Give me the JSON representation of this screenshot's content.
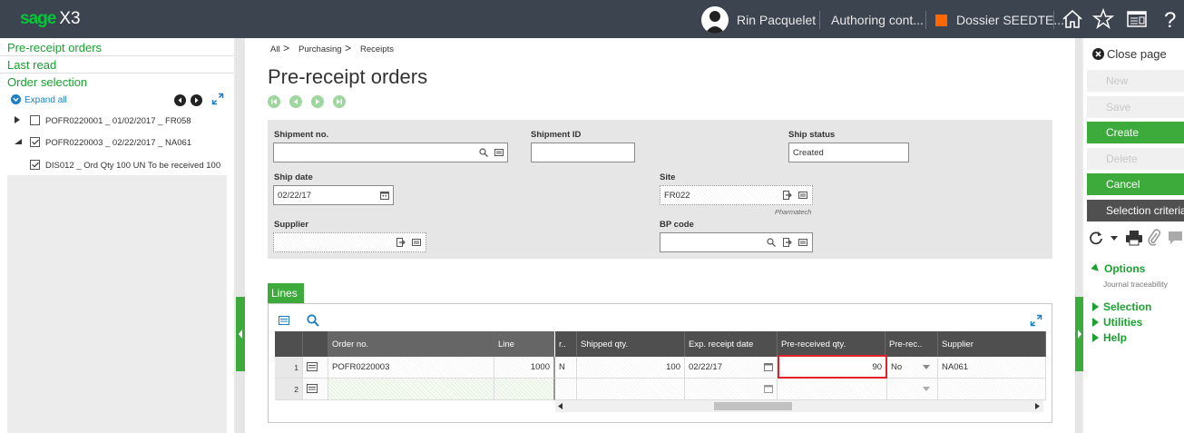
{
  "app": {
    "brand": "sage",
    "product": "X3"
  },
  "topbar": {
    "user": "Rin Pacquelet",
    "context": "Authoring cont...",
    "folder": "Dossier SEEDTE..."
  },
  "left_panel": {
    "links": [
      "Pre-receipt orders",
      "Last read",
      "Order selection"
    ],
    "expand_all": "Expand all",
    "tree": [
      {
        "label": "POFR0220001 _ 01/02/2017 _ FR058",
        "checked": false,
        "expander": "collapsed"
      },
      {
        "label": "POFR0220003 _ 02/22/2017 _ NA061",
        "checked": true,
        "expander": "expanded"
      },
      {
        "label": "DIS012 _ Ord Qty 100 UN To be received 100",
        "checked": true,
        "expander": "none"
      }
    ]
  },
  "breadcrumb": [
    "All",
    "Purchasing",
    "Receipts"
  ],
  "page": {
    "title": "Pre-receipt orders"
  },
  "form": {
    "shipment_no": {
      "label": "Shipment no.",
      "value": ""
    },
    "shipment_id": {
      "label": "Shipment ID",
      "value": ""
    },
    "ship_status": {
      "label": "Ship status",
      "value": "Created"
    },
    "ship_date": {
      "label": "Ship date",
      "value": "02/22/17"
    },
    "site": {
      "label": "Site",
      "value": "FR022",
      "caption": "Pharmatech"
    },
    "supplier": {
      "label": "Supplier",
      "value": ""
    },
    "bp_code": {
      "label": "BP code",
      "value": ""
    }
  },
  "lines": {
    "tab": "Lines",
    "columns": [
      "",
      "",
      "Order no.",
      "Line",
      "r..",
      "Shipped qty.",
      "Exp. receipt date",
      "Pre-received qty.",
      "Pre-rec..",
      "Supplier"
    ],
    "rows": [
      {
        "num": "1",
        "order_no": "POFR0220003",
        "line": "1000",
        "r": "N",
        "shipped": "100",
        "exp_date": "02/22/17",
        "pre_qty": "90",
        "pre_rec": "No",
        "supplier": "NA061"
      },
      {
        "num": "2",
        "order_no": "",
        "line": "",
        "r": "",
        "shipped": "",
        "exp_date": "",
        "pre_qty": "",
        "pre_rec": "",
        "supplier": ""
      }
    ]
  },
  "right_panel": {
    "close": "Close page",
    "buttons": [
      {
        "label": "New",
        "state": "disabled"
      },
      {
        "label": "Save",
        "state": "disabled"
      },
      {
        "label": "Create",
        "state": "enabled"
      },
      {
        "label": "Delete",
        "state": "disabled"
      },
      {
        "label": "Cancel",
        "state": "enabled"
      },
      {
        "label": "Selection criteria",
        "state": "dark"
      }
    ],
    "options": "Options",
    "options_sub": "Journal traceability",
    "sections": [
      "Selection",
      "Utilities",
      "Help"
    ]
  },
  "colors": {
    "accent": "#3cab3c",
    "topbar": "#3c4450",
    "highlight": "#e0202a",
    "folder": "#ff6600"
  }
}
